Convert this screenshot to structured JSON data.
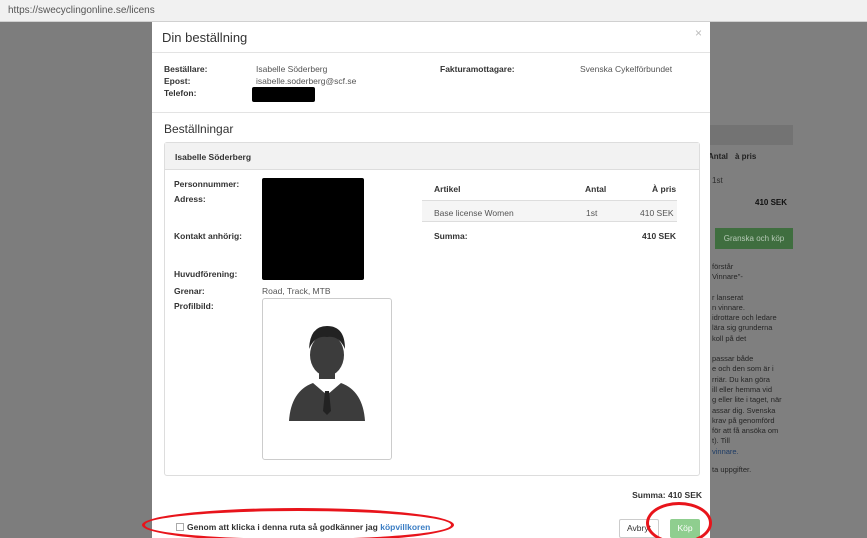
{
  "browser": {
    "url": "https://swecyclingonline.se/licens"
  },
  "modal": {
    "title": "Din beställning",
    "close": "×",
    "orderer_label": "Beställare:",
    "orderer_value": "Isabelle Söderberg",
    "email_label": "Epost:",
    "email_value": "isabelle.soderberg@scf.se",
    "phone_label": "Telefon:",
    "invoice_label": "Fakturamottagare:",
    "invoice_value": "Svenska Cykelförbundet",
    "orders_title": "Beställningar",
    "panel_name": "Isabelle Söderberg",
    "fields": {
      "personnummer": "Personnummer:",
      "adress": "Adress:",
      "kontakt": "Kontakt anhörig:",
      "huvudforening": "Huvudförening:",
      "grenar_label": "Grenar:",
      "grenar_value": "Road, Track, MTB",
      "profilbild": "Profilbild:"
    },
    "table": {
      "headers": [
        "Artikel",
        "Antal",
        "À pris"
      ],
      "row": [
        "Base license Women",
        "1st",
        "410 SEK"
      ],
      "sum_label": "Summa:",
      "sum_value": "410 SEK"
    },
    "total": "Summa: 410 SEK",
    "consent_text": "Genom att klicka i denna ruta så godkänner jag",
    "consent_link": "köpvillkoren",
    "cancel_button": "Avbryt",
    "buy_button": "Köp"
  },
  "background_page": {
    "col_antal": "Antal",
    "col_apris": "à pris",
    "qty": "1st",
    "price": "410 SEK",
    "review_button": "Granska och köp",
    "text_lines_1": [
      "förstår",
      "Vinnare\"-"
    ],
    "text_lines_2": [
      "r lanserat",
      "n vinnare.",
      "idrottare och ledare",
      "lära sig grunderna",
      "koll på det"
    ],
    "text_lines_3": [
      "passar både",
      "e och den som är i",
      "rriär. Du kan göra",
      "ill eller hemma vid",
      "g eller lite i taget, när",
      "assar dig. Svenska",
      "krav på genomförd",
      "för att få ansöka om",
      "t). Till"
    ],
    "link_text": "vinnare.",
    "last_line": "ta uppgifter."
  },
  "colors": {
    "buy_button": "#8fce8f",
    "link": "#3a7dc4",
    "annotation_ring": "#e8141b"
  },
  "icons": [
    "avatar-placeholder-icon"
  ]
}
